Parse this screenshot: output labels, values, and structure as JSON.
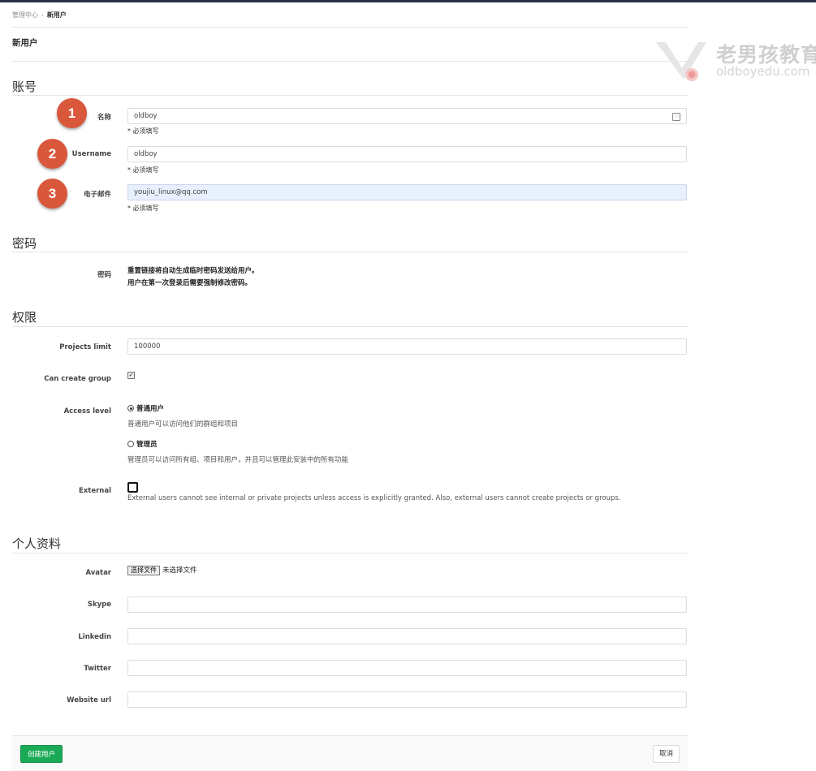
{
  "breadcrumb": {
    "parent": "管理中心",
    "separator": "›",
    "current": "新用户"
  },
  "page_title": "新用户",
  "sections": {
    "account": "账号",
    "password": "密码",
    "access": "权限",
    "profile": "个人资料"
  },
  "account": {
    "name": {
      "label": "名称",
      "value": "oldboy",
      "hint": "* 必须填写"
    },
    "username": {
      "label": "Username",
      "value": "oldboy",
      "hint": "* 必须填写"
    },
    "email": {
      "label": "电子邮件",
      "value": "youjiu_linux@qq.com",
      "hint": "* 必须填写"
    }
  },
  "annotations": [
    "1",
    "2",
    "3"
  ],
  "password": {
    "label": "密码",
    "line1": "重置链接将自动生成临时密码发送给用户。",
    "line2": "用户在第一次登录后需要强制修改密码。"
  },
  "access": {
    "projects_limit": {
      "label": "Projects limit",
      "value": "100000"
    },
    "can_create_group": {
      "label": "Can create group",
      "checked": true
    },
    "access_level": {
      "label": "Access level",
      "regular": {
        "label": "普通用户",
        "desc": "普通用户可以访问他们的群组和项目",
        "selected": true
      },
      "admin": {
        "label": "管理员",
        "desc": "管理员可以访问所有组、项目和用户，并且可以管理此安装中的所有功能",
        "selected": false
      }
    },
    "external": {
      "label": "External",
      "checked": false,
      "desc": "External users cannot see internal or private projects unless access is explicitly granted. Also, external users cannot create projects or groups."
    }
  },
  "profile": {
    "avatar": {
      "label": "Avatar",
      "button": "选择文件",
      "status": "未选择文件"
    },
    "skype": {
      "label": "Skype",
      "value": ""
    },
    "linkedin": {
      "label": "Linkedin",
      "value": ""
    },
    "twitter": {
      "label": "Twitter",
      "value": ""
    },
    "website": {
      "label": "Website url",
      "value": ""
    }
  },
  "footer": {
    "create_label": "创建用户",
    "cancel_label": "取消"
  },
  "watermark": {
    "title": "老男孩教育",
    "subtitle": "oldboyedu.com"
  },
  "colors": {
    "topbar": "#2b2f4a",
    "badge": "#d9573a",
    "primary_button": "#1aaa55",
    "focused_input": "#e8f0fe"
  }
}
